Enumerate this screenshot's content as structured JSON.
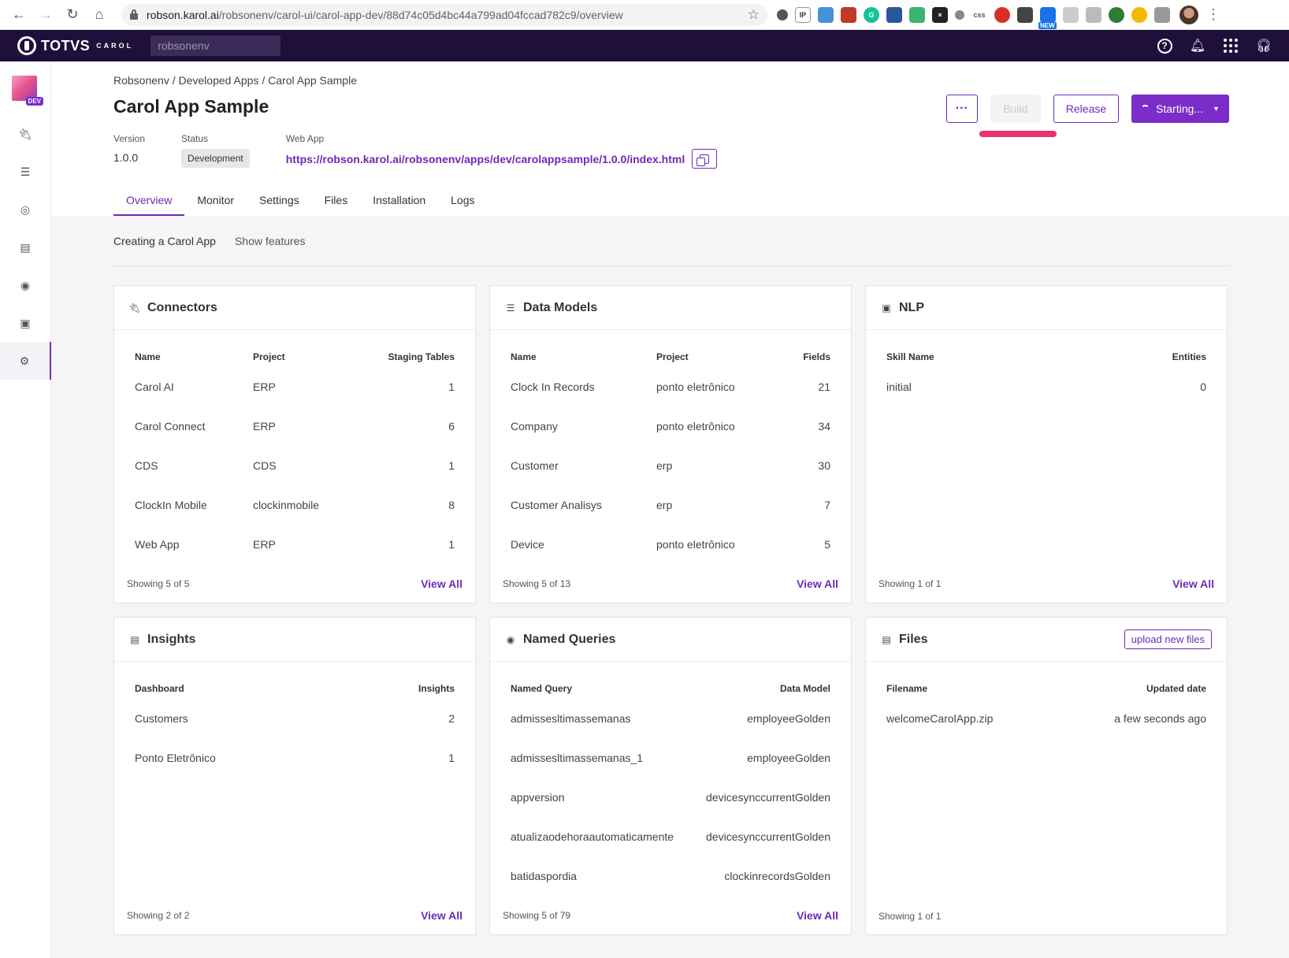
{
  "browser": {
    "url_domain": "robson.karol.ai",
    "url_path": "/robsonenv/carol-ui/carol-app-dev/88d74c05d4bc44a799ad04fccad782c9/overview",
    "ext_css": "css",
    "ext_new": "NEW"
  },
  "topbar": {
    "brand": "TOTVS",
    "brand_sub": "CAROL",
    "tenant_value": "robsonenv"
  },
  "sidebar": {
    "env_badge": "DEV"
  },
  "breadcrumb": [
    "Robsonenv",
    "Developed Apps",
    "Carol App Sample"
  ],
  "breadcrumb_sep": " / ",
  "page_title": "Carol App Sample",
  "meta": {
    "version_label": "Version",
    "version_value": "1.0.0",
    "status_label": "Status",
    "status_value": "Development",
    "webapp_label": "Web App",
    "webapp_url": "https://robson.karol.ai/robsonenv/apps/dev/carolappsample/1.0.0/index.html"
  },
  "actions": {
    "more": "···",
    "build": "Build",
    "release": "Release",
    "starting": "Starting..."
  },
  "tabs": [
    "Overview",
    "Monitor",
    "Settings",
    "Files",
    "Installation",
    "Logs"
  ],
  "subnav": {
    "active": "Creating a Carol App",
    "link": "Show features"
  },
  "view_all": "View All",
  "cards": {
    "connectors": {
      "title": "Connectors",
      "headers": [
        "Name",
        "Project",
        "Staging Tables"
      ],
      "rows": [
        [
          "Carol AI",
          "ERP",
          "1"
        ],
        [
          "Carol Connect",
          "ERP",
          "6"
        ],
        [
          "CDS",
          "CDS",
          "1"
        ],
        [
          "ClockIn Mobile",
          "clockinmobile",
          "8"
        ],
        [
          "Web App",
          "ERP",
          "1"
        ]
      ],
      "showing": "Showing 5 of 5"
    },
    "datamodels": {
      "title": "Data Models",
      "headers": [
        "Name",
        "Project",
        "Fields"
      ],
      "rows": [
        [
          "Clock In Records",
          "ponto eletrônico",
          "21"
        ],
        [
          "Company",
          "ponto eletrônico",
          "34"
        ],
        [
          "Customer",
          "erp",
          "30"
        ],
        [
          "Customer Analisys",
          "erp",
          "7"
        ],
        [
          "Device",
          "ponto eletrônico",
          "5"
        ]
      ],
      "showing": "Showing 5 of 13"
    },
    "nlp": {
      "title": "NLP",
      "headers": [
        "Skill Name",
        "Entities"
      ],
      "rows": [
        [
          "initial",
          "0"
        ]
      ],
      "showing": "Showing 1 of 1"
    },
    "insights": {
      "title": "Insights",
      "headers": [
        "Dashboard",
        "Insights"
      ],
      "rows": [
        [
          "Customers",
          "2"
        ],
        [
          "Ponto Eletrônico",
          "1"
        ]
      ],
      "showing": "Showing 2 of 2"
    },
    "queries": {
      "title": "Named Queries",
      "headers": [
        "Named Query",
        "Data Model"
      ],
      "rows": [
        [
          "admissesltimassemanas",
          "employeeGolden"
        ],
        [
          "admissesltimassemanas_1",
          "employeeGolden"
        ],
        [
          "appversion",
          "devicesynccurrentGolden"
        ],
        [
          "atualizaodehoraautomaticamente",
          "devicesynccurrentGolden"
        ],
        [
          "batidaspordia",
          "clockinrecordsGolden"
        ]
      ],
      "showing": "Showing 5 of 79"
    },
    "files": {
      "title": "Files",
      "upload": "upload new files",
      "headers": [
        "Filename",
        "Updated date"
      ],
      "rows": [
        [
          "welcomeCarolApp.zip",
          "a few seconds ago"
        ]
      ],
      "showing": "Showing 1 of 1"
    }
  }
}
